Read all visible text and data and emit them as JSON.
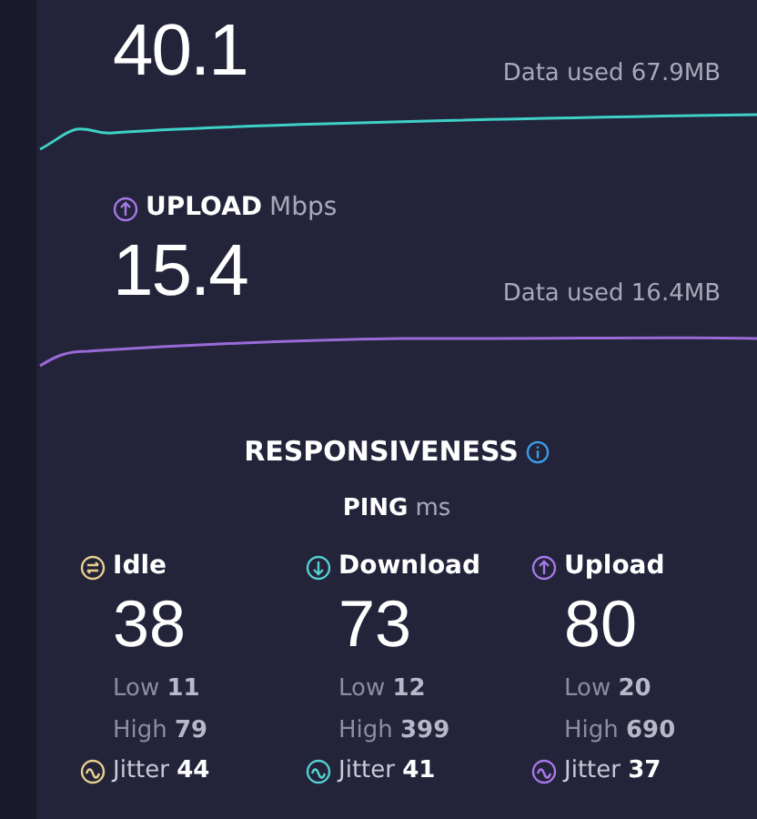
{
  "download": {
    "value": "40.1",
    "data_used": "Data used 67.9MB"
  },
  "upload": {
    "label": "UPLOAD",
    "unit": "Mbps",
    "value": "15.4",
    "data_used": "Data used 16.4MB"
  },
  "responsiveness": {
    "title": "RESPONSIVENESS",
    "ping_label": "PING",
    "ping_unit": "ms",
    "columns": [
      {
        "kind": "idle",
        "color": "#e8cf8e",
        "label": "Idle",
        "value": "38",
        "low_label": "Low",
        "low": "11",
        "high_label": "High",
        "high": "79",
        "jitter_label": "Jitter",
        "jitter": "44"
      },
      {
        "kind": "download",
        "color": "#56d0d0",
        "label": "Download",
        "value": "73",
        "low_label": "Low",
        "low": "12",
        "high_label": "High",
        "high": "399",
        "jitter_label": "Jitter",
        "jitter": "41"
      },
      {
        "kind": "upload",
        "color": "#a779e9",
        "label": "Upload",
        "value": "80",
        "low_label": "Low",
        "low": "20",
        "high_label": "High",
        "high": "690",
        "jitter_label": "Jitter",
        "jitter": "37"
      }
    ]
  }
}
